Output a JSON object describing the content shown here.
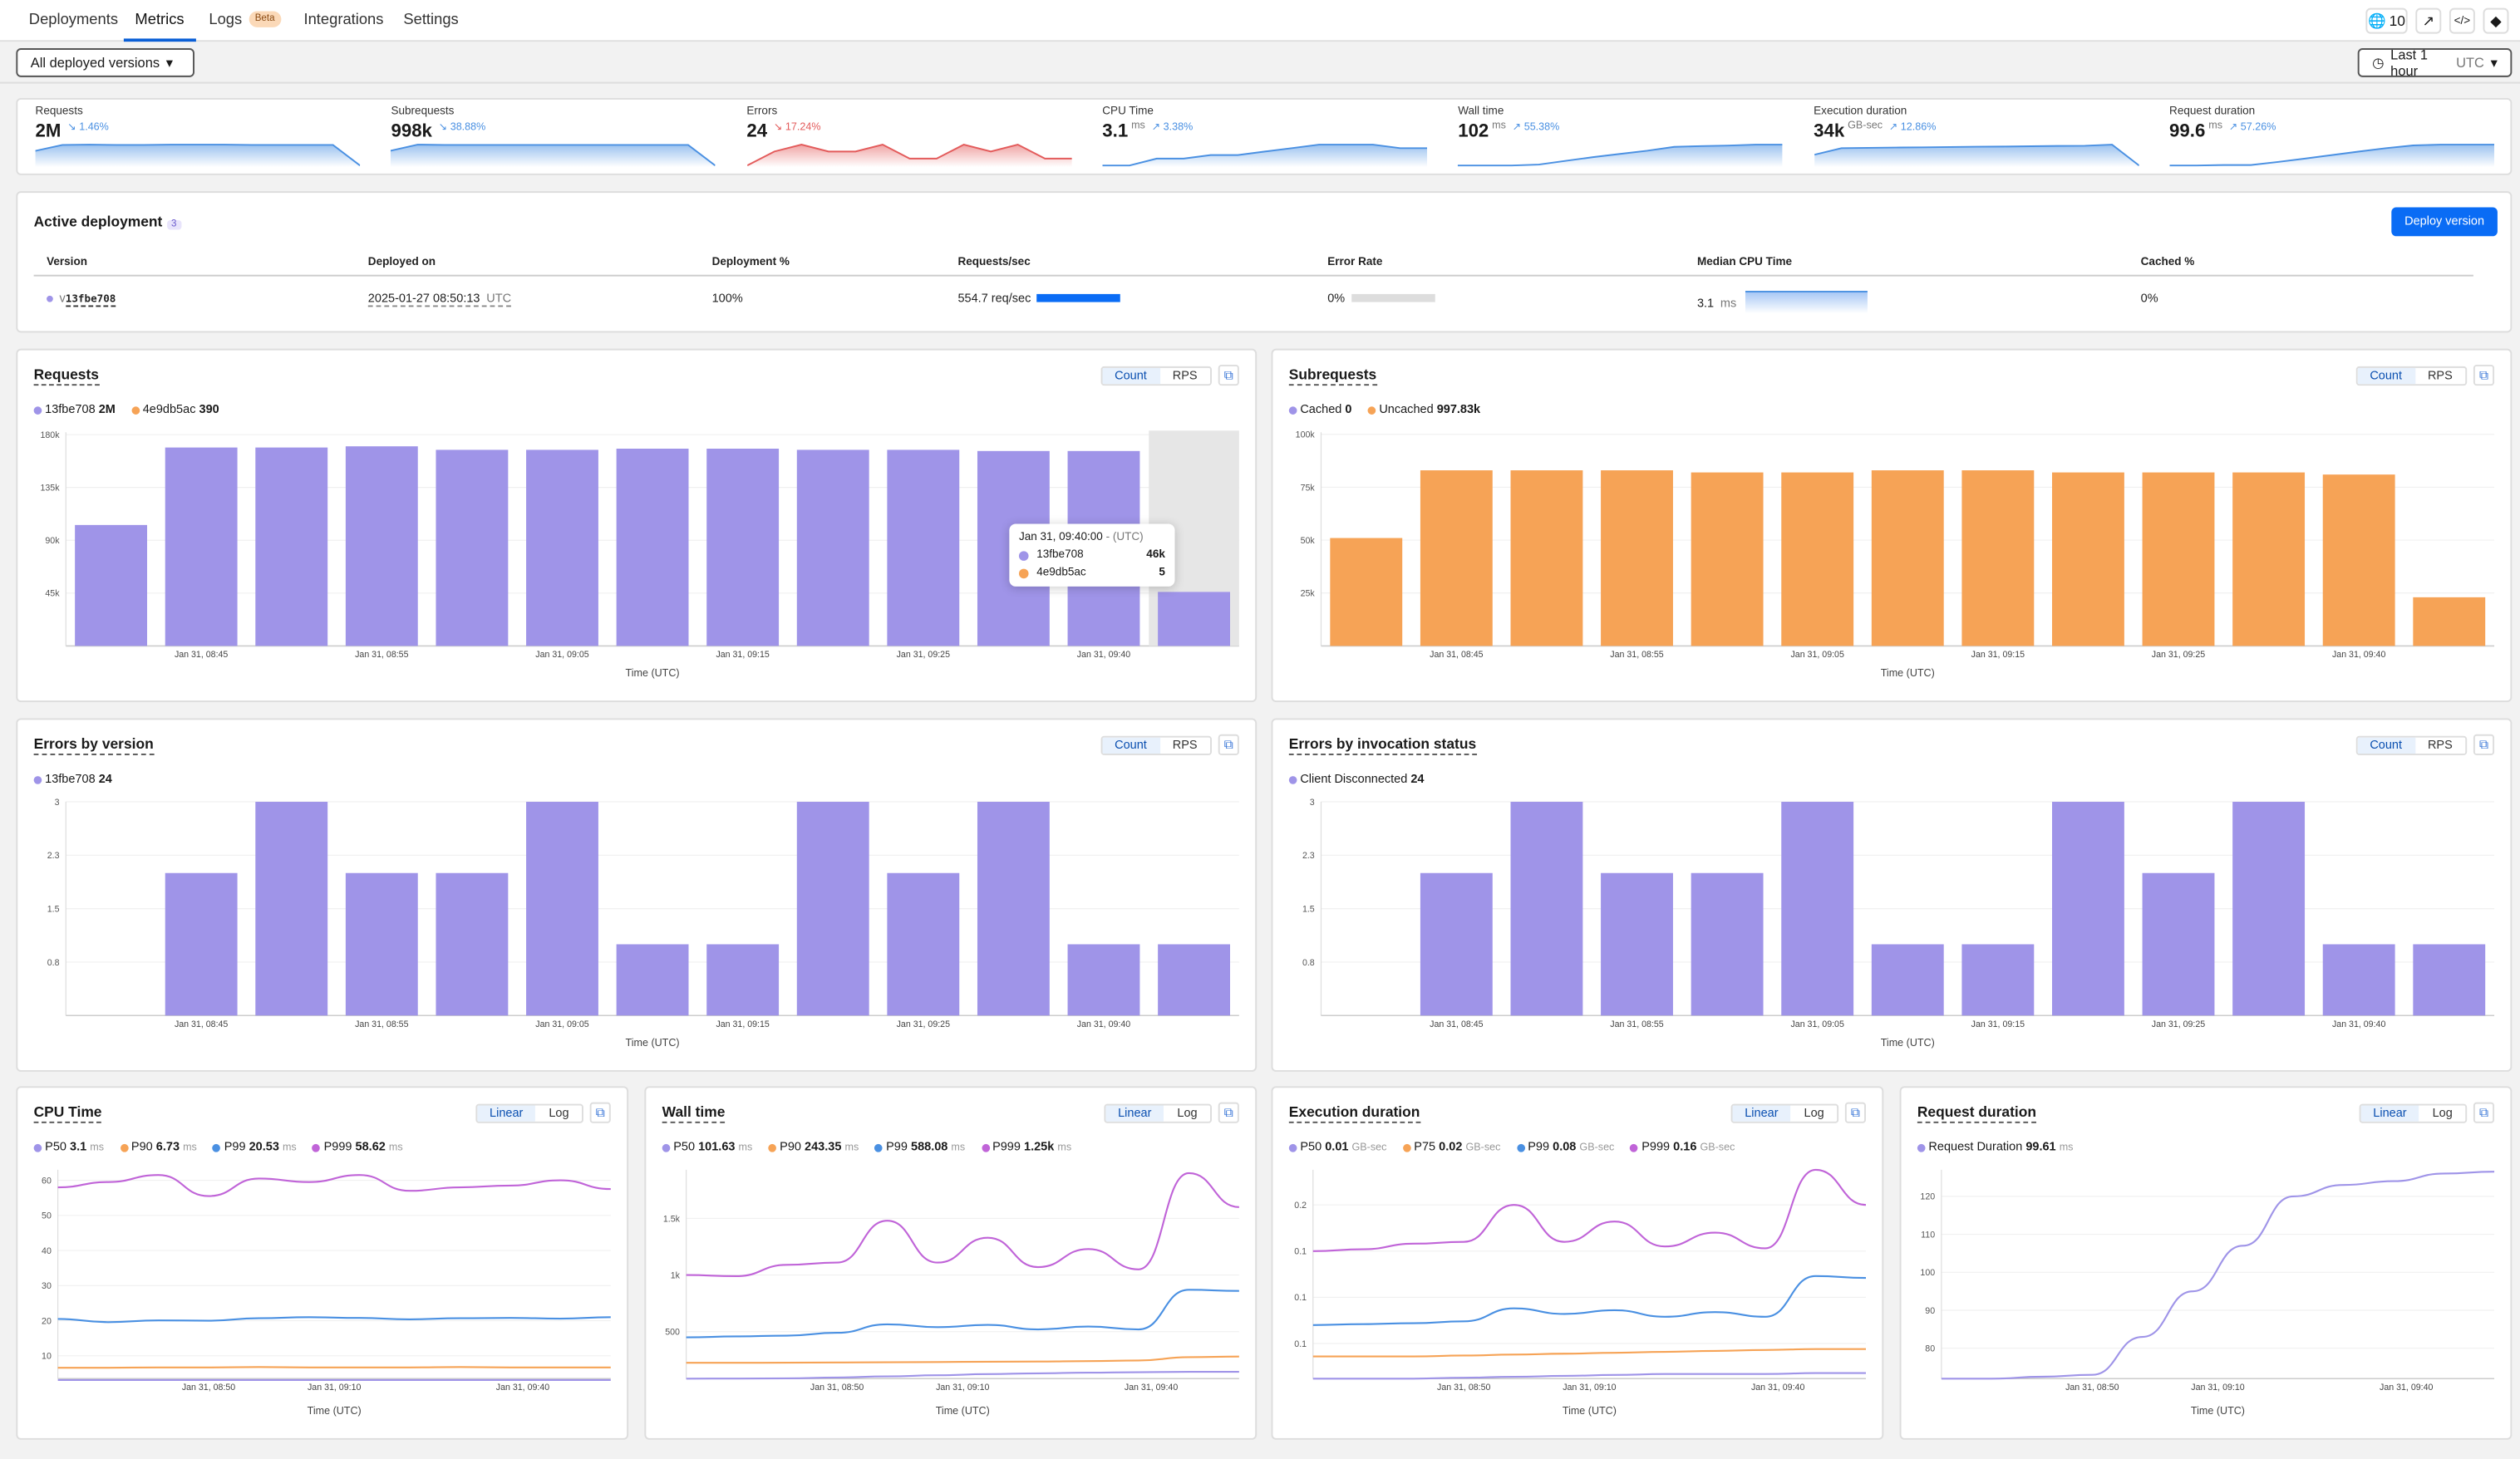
{
  "nav": {
    "tabs": [
      {
        "label": "Deployments"
      },
      {
        "label": "Metrics",
        "active": true
      },
      {
        "label": "Logs",
        "badge": "Beta"
      },
      {
        "label": "Integrations"
      },
      {
        "label": "Settings"
      }
    ],
    "routes_count": "10",
    "icons": [
      "globe-icon",
      "external-link-icon",
      "code-icon",
      "git-icon"
    ]
  },
  "filters": {
    "version_select": "All deployed versions",
    "time_range": "Last 1 hour",
    "time_zone": "UTC"
  },
  "stats": [
    {
      "label": "Requests",
      "value": "2M",
      "unit": "",
      "change": "↘ 1.46%",
      "color": "#4a90e2",
      "trend": [
        70,
        95,
        96,
        95,
        95,
        96,
        96,
        96,
        95,
        95,
        95,
        95,
        10
      ]
    },
    {
      "label": "Subrequests",
      "value": "998k",
      "unit": "",
      "change": "↘ 38.88%",
      "color": "#4a90e2",
      "trend": [
        70,
        95,
        94,
        94,
        94,
        94,
        94,
        94,
        94,
        94,
        94,
        94,
        10
      ]
    },
    {
      "label": "Errors",
      "value": "24",
      "unit": "",
      "change": "↘ 17.24%",
      "color": "#e35b5b",
      "trend": [
        0,
        2,
        3,
        2,
        2,
        3,
        1,
        1,
        3,
        2,
        3,
        1,
        1
      ]
    },
    {
      "label": "CPU Time",
      "value": "3.1",
      "unit": "ms",
      "change": "↗ 3.38%",
      "color": "#4a90e2",
      "trend": [
        3.0,
        3.0,
        3.02,
        3.02,
        3.03,
        3.03,
        3.04,
        3.05,
        3.06,
        3.06,
        3.06,
        3.05,
        3.05
      ]
    },
    {
      "label": "Wall time",
      "value": "102",
      "unit": "ms",
      "change": "↗ 55.38%",
      "color": "#4a90e2",
      "trend": [
        70,
        70,
        70,
        72,
        80,
        88,
        95,
        102,
        110,
        112,
        113,
        115,
        115
      ]
    },
    {
      "label": "Execution duration",
      "value": "34k",
      "unit": "GB-sec",
      "change": "↗ 12.86%",
      "color": "#4a90e2",
      "trend": [
        60,
        85,
        86,
        87,
        88,
        89,
        90,
        91,
        92,
        93,
        94,
        98,
        20
      ]
    },
    {
      "label": "Request duration",
      "value": "99.6",
      "unit": "ms",
      "change": "↗ 57.26%",
      "color": "#4a90e2",
      "trend": [
        72,
        72,
        73,
        73,
        80,
        88,
        96,
        104,
        112,
        118,
        120,
        120,
        120
      ]
    }
  ],
  "active_deployment": {
    "title": "Active deployment",
    "count_badge": "3",
    "deploy_button": "Deploy version",
    "columns": [
      "Version",
      "Deployed on",
      "Deployment %",
      "Requests/sec",
      "Error Rate",
      "Median CPU Time",
      "Cached %"
    ],
    "row": {
      "version_prefix": "v",
      "version": "13fbe708",
      "deployed_on": "2025-01-27 08:50:13",
      "deployed_tz": "UTC",
      "deployment_pct": "100%",
      "rps": "554.7 req/sec",
      "rps_fraction": 1.0,
      "error_rate": "0%",
      "error_fraction": 0.0,
      "median_cpu": "3.1",
      "median_cpu_unit": "ms",
      "cached": "0%"
    }
  },
  "chart_data": [
    {
      "type": "bar",
      "title": "Requests",
      "toggle": [
        "Count",
        "RPS"
      ],
      "active_toggle": "Count",
      "legend": [
        {
          "name": "13fbe708",
          "value": "2M",
          "color": "#9f94e8"
        },
        {
          "name": "4e9db5ac",
          "value": "390",
          "color": "#f6a356"
        }
      ],
      "values": [
        103000,
        169000,
        169000,
        170000,
        167000,
        167000,
        168000,
        168000,
        167000,
        167000,
        166000,
        166000,
        46000
      ],
      "color": "#9f94e8",
      "ylim": [
        0,
        182000
      ],
      "yticks": [
        45000,
        90000,
        135000,
        180000
      ],
      "ytick_labels": [
        "45k",
        "90k",
        "135k",
        "180k"
      ],
      "xtick_labels": [
        {
          "i": 1,
          "label": "Jan 31, 08:45"
        },
        {
          "i": 3,
          "label": "Jan 31, 08:55"
        },
        {
          "i": 5,
          "label": "Jan 31, 09:05"
        },
        {
          "i": 7,
          "label": "Jan 31, 09:15"
        },
        {
          "i": 9,
          "label": "Jan 31, 09:25"
        },
        {
          "i": 11,
          "label": "Jan 31, 09:40"
        }
      ],
      "xlabel": "Time (UTC)",
      "hover_index": 12,
      "tooltip": {
        "time": "Jan 31, 09:40:00",
        "tz": "- (UTC)",
        "rows": [
          {
            "name": "13fbe708",
            "value": "46k",
            "color": "#9f94e8"
          },
          {
            "name": "4e9db5ac",
            "value": "5",
            "color": "#f6a356"
          }
        ]
      }
    },
    {
      "type": "bar",
      "title": "Subrequests",
      "toggle": [
        "Count",
        "RPS"
      ],
      "active_toggle": "Count",
      "legend": [
        {
          "name": "Cached",
          "value": "0",
          "color": "#9f94e8"
        },
        {
          "name": "Uncached",
          "value": "997.83k",
          "color": "#f6a356"
        }
      ],
      "values": [
        51000,
        83000,
        83000,
        83000,
        82000,
        82000,
        83000,
        83000,
        82000,
        82000,
        82000,
        81000,
        23000
      ],
      "color": "#f6a356",
      "ylim": [
        0,
        101000
      ],
      "yticks": [
        25000,
        50000,
        75000,
        100000
      ],
      "ytick_labels": [
        "25k",
        "50k",
        "75k",
        "100k"
      ],
      "xtick_labels": [
        {
          "i": 1,
          "label": "Jan 31, 08:45"
        },
        {
          "i": 3,
          "label": "Jan 31, 08:55"
        },
        {
          "i": 5,
          "label": "Jan 31, 09:05"
        },
        {
          "i": 7,
          "label": "Jan 31, 09:15"
        },
        {
          "i": 9,
          "label": "Jan 31, 09:25"
        },
        {
          "i": 11,
          "label": "Jan 31, 09:40"
        }
      ],
      "xlabel": "Time (UTC)"
    },
    {
      "type": "bar",
      "title": "Errors by version",
      "toggle": [
        "Count",
        "RPS"
      ],
      "active_toggle": "Count",
      "legend": [
        {
          "name": "13fbe708",
          "value": "24",
          "color": "#9f94e8"
        }
      ],
      "values": [
        0,
        2,
        3,
        2,
        2,
        3,
        1,
        1,
        3,
        2,
        3,
        1,
        1
      ],
      "color": "#9f94e8",
      "ylim": [
        0,
        3
      ],
      "yticks": [
        0.75,
        1.5,
        2.25,
        3
      ],
      "ytick_labels": [
        "0.8",
        "1.5",
        "2.3",
        "3"
      ],
      "xtick_labels": [
        {
          "i": 1,
          "label": "Jan 31, 08:45"
        },
        {
          "i": 3,
          "label": "Jan 31, 08:55"
        },
        {
          "i": 5,
          "label": "Jan 31, 09:05"
        },
        {
          "i": 7,
          "label": "Jan 31, 09:15"
        },
        {
          "i": 9,
          "label": "Jan 31, 09:25"
        },
        {
          "i": 11,
          "label": "Jan 31, 09:40"
        }
      ],
      "xlabel": "Time (UTC)"
    },
    {
      "type": "bar",
      "title": "Errors by invocation status",
      "toggle": [
        "Count",
        "RPS"
      ],
      "active_toggle": "Count",
      "legend": [
        {
          "name": "Client Disconnected",
          "value": "24",
          "color": "#9f94e8"
        }
      ],
      "values": [
        0,
        2,
        3,
        2,
        2,
        3,
        1,
        1,
        3,
        2,
        3,
        1,
        1
      ],
      "color": "#9f94e8",
      "ylim": [
        0,
        3
      ],
      "yticks": [
        0.75,
        1.5,
        2.25,
        3
      ],
      "ytick_labels": [
        "0.8",
        "1.5",
        "2.3",
        "3"
      ],
      "xtick_labels": [
        {
          "i": 1,
          "label": "Jan 31, 08:45"
        },
        {
          "i": 3,
          "label": "Jan 31, 08:55"
        },
        {
          "i": 5,
          "label": "Jan 31, 09:05"
        },
        {
          "i": 7,
          "label": "Jan 31, 09:15"
        },
        {
          "i": 9,
          "label": "Jan 31, 09:25"
        },
        {
          "i": 11,
          "label": "Jan 31, 09:40"
        }
      ],
      "xlabel": "Time (UTC)"
    },
    {
      "type": "line",
      "title": "CPU Time",
      "toggle": [
        "Linear",
        "Log"
      ],
      "active_toggle": "Linear",
      "x": [
        "08:26",
        "08:34",
        "08:42",
        "08:50",
        "08:58",
        "09:06",
        "09:14",
        "09:22",
        "09:30",
        "09:38",
        "09:46",
        "09:54"
      ],
      "series": [
        {
          "name": "P50",
          "value": "3.1",
          "unit": "ms",
          "color": "#9f94e8",
          "values": [
            3.1,
            3.1,
            3.1,
            3.1,
            3.1,
            3.1,
            3.1,
            3.1,
            3.1,
            3.1,
            3.1,
            3.1
          ]
        },
        {
          "name": "P90",
          "value": "6.73",
          "unit": "ms",
          "color": "#f6a356",
          "values": [
            6.6,
            6.6,
            6.7,
            6.7,
            6.8,
            6.7,
            6.7,
            6.7,
            6.8,
            6.7,
            6.7,
            6.7
          ]
        },
        {
          "name": "P99",
          "value": "20.53",
          "unit": "ms",
          "color": "#4a90e2",
          "values": [
            20.5,
            19.6,
            20.1,
            20,
            20.7,
            21,
            20.8,
            20.4,
            20.7,
            20.8,
            20.6,
            21
          ]
        },
        {
          "name": "P999",
          "value": "58.62",
          "unit": "ms",
          "color": "#c064d8",
          "values": [
            58,
            59.5,
            61.5,
            55.5,
            60.5,
            59.5,
            61.5,
            57,
            58,
            58.5,
            60,
            57.5
          ]
        }
      ],
      "ylim": [
        3.5,
        63
      ],
      "yticks": [
        10,
        20,
        30,
        40,
        50,
        60
      ],
      "ytick_labels": [
        "10",
        "20",
        "30",
        "40",
        "50",
        "60"
      ],
      "xtick_labels": [
        {
          "t": "08:50",
          "label": "Jan 31, 08:50"
        },
        {
          "t": "09:10",
          "label": "Jan 31, 09:10"
        },
        {
          "t": "09:40",
          "label": "Jan 31, 09:40"
        }
      ],
      "xlabel": "Time (UTC)"
    },
    {
      "type": "line",
      "title": "Wall time",
      "toggle": [
        "Linear",
        "Log"
      ],
      "active_toggle": "Linear",
      "x": [
        "08:26",
        "08:34",
        "08:42",
        "08:50",
        "08:58",
        "09:06",
        "09:14",
        "09:22",
        "09:30",
        "09:38",
        "09:46",
        "09:54"
      ],
      "series": [
        {
          "name": "P50",
          "value": "101.63",
          "unit": "ms",
          "color": "#9f94e8",
          "values": [
            85,
            86,
            88,
            95,
            105,
            115,
            125,
            132,
            138,
            142,
            145,
            145
          ]
        },
        {
          "name": "P90",
          "value": "243.35",
          "unit": "ms",
          "color": "#f6a356",
          "values": [
            225,
            225,
            226,
            228,
            230,
            232,
            234,
            236,
            240,
            245,
            275,
            280
          ]
        },
        {
          "name": "P99",
          "value": "588.08",
          "unit": "ms",
          "color": "#4a90e2",
          "values": [
            450,
            458,
            465,
            490,
            565,
            540,
            560,
            520,
            545,
            520,
            870,
            860
          ]
        },
        {
          "name": "P999",
          "value": "1.25k",
          "unit": "ms",
          "color": "#c064d8",
          "values": [
            1000,
            990,
            1090,
            1110,
            1480,
            1110,
            1330,
            1070,
            1230,
            1050,
            1900,
            1600
          ]
        }
      ],
      "ylim": [
        85,
        1930
      ],
      "yticks": [
        500,
        1000,
        1500
      ],
      "ytick_labels": [
        "500",
        "1k",
        "1.5k"
      ],
      "xtick_labels": [
        {
          "t": "08:50",
          "label": "Jan 31, 08:50"
        },
        {
          "t": "09:10",
          "label": "Jan 31, 09:10"
        },
        {
          "t": "09:40",
          "label": "Jan 31, 09:40"
        }
      ],
      "xlabel": "Time (UTC)"
    },
    {
      "type": "line",
      "title": "Execution duration",
      "toggle": [
        "Linear",
        "Log"
      ],
      "active_toggle": "Linear",
      "x": [
        "08:26",
        "08:34",
        "08:42",
        "08:50",
        "08:58",
        "09:06",
        "09:14",
        "09:22",
        "09:30",
        "09:38",
        "09:46",
        "09:54"
      ],
      "series": [
        {
          "name": "P50",
          "value": "0.01",
          "unit": "GB-sec",
          "color": "#9f94e8",
          "values": [
            0.012,
            0.012,
            0.012,
            0.013,
            0.014,
            0.015,
            0.016,
            0.017,
            0.017,
            0.017,
            0.018,
            0.018
          ]
        },
        {
          "name": "P75",
          "value": "0.02",
          "unit": "GB-sec",
          "color": "#f6a356",
          "values": [
            0.036,
            0.036,
            0.036,
            0.037,
            0.038,
            0.039,
            0.04,
            0.041,
            0.042,
            0.043,
            0.044,
            0.044
          ]
        },
        {
          "name": "P99",
          "value": "0.08",
          "unit": "GB-sec",
          "color": "#4a90e2",
          "values": [
            0.07,
            0.071,
            0.072,
            0.074,
            0.088,
            0.082,
            0.086,
            0.079,
            0.084,
            0.079,
            0.123,
            0.121
          ]
        },
        {
          "name": "P999",
          "value": "0.16",
          "unit": "GB-sec",
          "color": "#c064d8",
          "values": [
            0.15,
            0.152,
            0.158,
            0.16,
            0.2,
            0.16,
            0.182,
            0.155,
            0.17,
            0.153,
            0.238,
            0.2
          ]
        }
      ],
      "ylim": [
        0.012,
        0.238
      ],
      "yticks": [
        0.05,
        0.1,
        0.15,
        0.2
      ],
      "ytick_labels": [
        "0.1",
        "0.1",
        "0.1",
        "0.2"
      ],
      "xtick_labels": [
        {
          "t": "08:50",
          "label": "Jan 31, 08:50"
        },
        {
          "t": "09:10",
          "label": "Jan 31, 09:10"
        },
        {
          "t": "09:40",
          "label": "Jan 31, 09:40"
        }
      ],
      "xlabel": "Time (UTC)"
    },
    {
      "type": "line",
      "title": "Request duration",
      "toggle": [
        "Linear",
        "Log"
      ],
      "active_toggle": "Linear",
      "x": [
        "08:26",
        "08:34",
        "08:42",
        "08:50",
        "08:58",
        "09:06",
        "09:14",
        "09:22",
        "09:30",
        "09:38",
        "09:46",
        "09:54"
      ],
      "series": [
        {
          "name": "Request Duration",
          "value": "99.61",
          "unit": "ms",
          "color": "#9f94e8",
          "values": [
            72,
            72,
            72.5,
            73,
            83,
            95,
            107,
            120,
            123,
            124,
            126,
            126.5
          ]
        }
      ],
      "ylim": [
        72,
        127
      ],
      "yticks": [
        80,
        90,
        100,
        110,
        120
      ],
      "ytick_labels": [
        "80",
        "90",
        "100",
        "110",
        "120"
      ],
      "xtick_labels": [
        {
          "t": "08:50",
          "label": "Jan 31, 08:50"
        },
        {
          "t": "09:10",
          "label": "Jan 31, 09:10"
        },
        {
          "t": "09:40",
          "label": "Jan 31, 09:40"
        }
      ],
      "xlabel": "Time (UTC)"
    }
  ]
}
